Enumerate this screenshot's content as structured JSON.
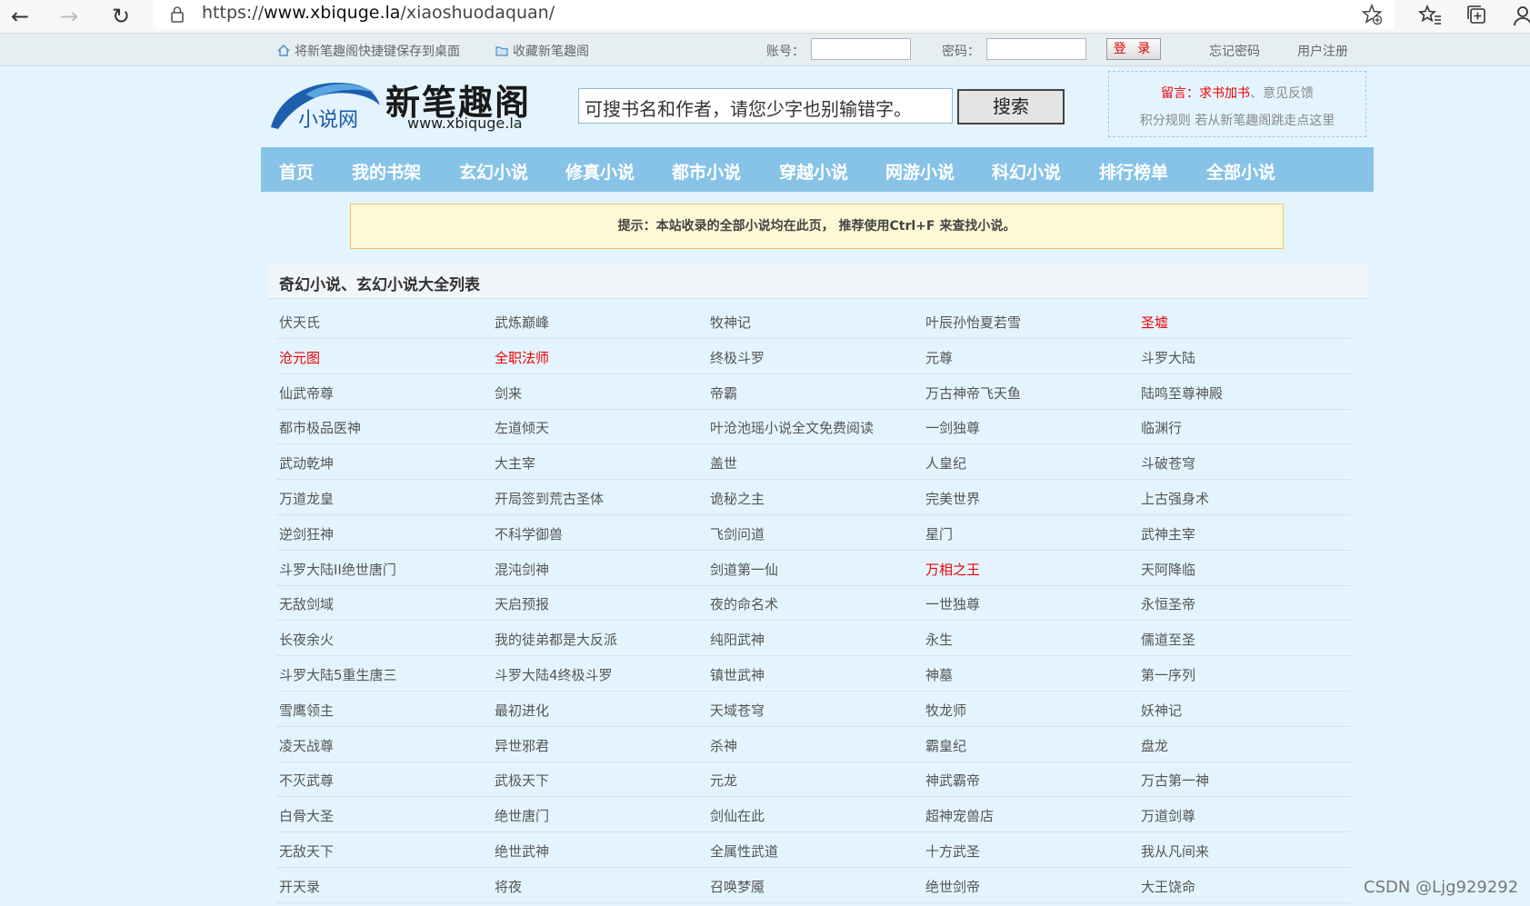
{
  "browser": {
    "url_prefix": "https://",
    "url_host": "www.xbiquge.la",
    "url_path": "/xiaoshuodaquan/"
  },
  "topbar": {
    "save_shortcut": "将新笔趣阁快捷键保存到桌面",
    "bookmark": "收藏新笔趣阁",
    "account_label": "账号：",
    "password_label": "密码：",
    "login_button": "登 录",
    "forgot_password": "忘记密码",
    "register": "用户注册"
  },
  "header": {
    "logo_main": "新笔趣阁",
    "logo_sub": "小说网",
    "logo_domain": "www.xbiquge.la",
    "search_placeholder": "可搜书名和作者，请您少字也别输错字。",
    "search_button": "搜索",
    "notice_prefix": "留言：",
    "notice_request": "求书加书",
    "notice_sep": "、",
    "notice_feedback": "意见反馈",
    "notice_line2": "积分规则   若从新笔趣阁跳走点这里"
  },
  "nav": [
    "首页",
    "我的书架",
    "玄幻小说",
    "修真小说",
    "都市小说",
    "穿越小说",
    "网游小说",
    "科幻小说",
    "排行榜单",
    "全部小说"
  ],
  "tip": "提示：本站收录的全部小说均在此页， 推荐使用Ctrl+F 来查找小说。",
  "list": {
    "title": "奇幻小说、玄幻小说大全列表",
    "rows": [
      [
        {
          "t": "伏天氏",
          "hot": false
        },
        {
          "t": "武炼巅峰",
          "hot": false
        },
        {
          "t": "牧神记",
          "hot": false
        },
        {
          "t": "叶辰孙怡夏若雪",
          "hot": false
        },
        {
          "t": "圣墟",
          "hot": true
        }
      ],
      [
        {
          "t": "沧元图",
          "hot": true
        },
        {
          "t": "全职法师",
          "hot": true
        },
        {
          "t": "终极斗罗",
          "hot": false
        },
        {
          "t": "元尊",
          "hot": false
        },
        {
          "t": "斗罗大陆",
          "hot": false
        }
      ],
      [
        {
          "t": "仙武帝尊",
          "hot": false
        },
        {
          "t": "剑来",
          "hot": false
        },
        {
          "t": "帝霸",
          "hot": false
        },
        {
          "t": "万古神帝飞天鱼",
          "hot": false
        },
        {
          "t": "陆鸣至尊神殿",
          "hot": false
        }
      ],
      [
        {
          "t": "都市极品医神",
          "hot": false
        },
        {
          "t": "左道倾天",
          "hot": false
        },
        {
          "t": "叶沧池瑶小说全文免费阅读",
          "hot": false
        },
        {
          "t": "一剑独尊",
          "hot": false
        },
        {
          "t": "临渊行",
          "hot": false
        }
      ],
      [
        {
          "t": "武动乾坤",
          "hot": false
        },
        {
          "t": "大主宰",
          "hot": false
        },
        {
          "t": "盖世",
          "hot": false
        },
        {
          "t": "人皇纪",
          "hot": false
        },
        {
          "t": "斗破苍穹",
          "hot": false
        }
      ],
      [
        {
          "t": "万道龙皇",
          "hot": false
        },
        {
          "t": "开局签到荒古圣体",
          "hot": false
        },
        {
          "t": "诡秘之主",
          "hot": false
        },
        {
          "t": "完美世界",
          "hot": false
        },
        {
          "t": "上古强身术",
          "hot": false
        }
      ],
      [
        {
          "t": "逆剑狂神",
          "hot": false
        },
        {
          "t": "不科学御兽",
          "hot": false
        },
        {
          "t": "飞剑问道",
          "hot": false
        },
        {
          "t": "星门",
          "hot": false
        },
        {
          "t": "武神主宰",
          "hot": false
        }
      ],
      [
        {
          "t": "斗罗大陆II绝世唐门",
          "hot": false
        },
        {
          "t": "混沌剑神",
          "hot": false
        },
        {
          "t": "剑道第一仙",
          "hot": false
        },
        {
          "t": "万相之王",
          "hot": true
        },
        {
          "t": "天阿降临",
          "hot": false
        }
      ],
      [
        {
          "t": "无敌剑域",
          "hot": false
        },
        {
          "t": "天启预报",
          "hot": false
        },
        {
          "t": "夜的命名术",
          "hot": false
        },
        {
          "t": "一世独尊",
          "hot": false
        },
        {
          "t": "永恒圣帝",
          "hot": false
        }
      ],
      [
        {
          "t": "长夜余火",
          "hot": false
        },
        {
          "t": "我的徒弟都是大反派",
          "hot": false
        },
        {
          "t": "纯阳武神",
          "hot": false
        },
        {
          "t": "永生",
          "hot": false
        },
        {
          "t": "儒道至圣",
          "hot": false
        }
      ],
      [
        {
          "t": "斗罗大陆5重生唐三",
          "hot": false
        },
        {
          "t": "斗罗大陆4终极斗罗",
          "hot": false
        },
        {
          "t": "镇世武神",
          "hot": false
        },
        {
          "t": "神墓",
          "hot": false
        },
        {
          "t": "第一序列",
          "hot": false
        }
      ],
      [
        {
          "t": "雪鹰领主",
          "hot": false
        },
        {
          "t": "最初进化",
          "hot": false
        },
        {
          "t": "天域苍穹",
          "hot": false
        },
        {
          "t": "牧龙师",
          "hot": false
        },
        {
          "t": "妖神记",
          "hot": false
        }
      ],
      [
        {
          "t": "凌天战尊",
          "hot": false
        },
        {
          "t": "异世邪君",
          "hot": false
        },
        {
          "t": "杀神",
          "hot": false
        },
        {
          "t": "霸皇纪",
          "hot": false
        },
        {
          "t": "盘龙",
          "hot": false
        }
      ],
      [
        {
          "t": "不灭武尊",
          "hot": false
        },
        {
          "t": "武极天下",
          "hot": false
        },
        {
          "t": "元龙",
          "hot": false
        },
        {
          "t": "神武霸帝",
          "hot": false
        },
        {
          "t": "万古第一神",
          "hot": false
        }
      ],
      [
        {
          "t": "白骨大圣",
          "hot": false
        },
        {
          "t": "绝世唐门",
          "hot": false
        },
        {
          "t": "剑仙在此",
          "hot": false
        },
        {
          "t": "超神宠兽店",
          "hot": false
        },
        {
          "t": "万道剑尊",
          "hot": false
        }
      ],
      [
        {
          "t": "无敌天下",
          "hot": false
        },
        {
          "t": "绝世武神",
          "hot": false
        },
        {
          "t": "全属性武道",
          "hot": false
        },
        {
          "t": "十方武圣",
          "hot": false
        },
        {
          "t": "我从凡间来",
          "hot": false
        }
      ],
      [
        {
          "t": "开天录",
          "hot": false
        },
        {
          "t": "将夜",
          "hot": false
        },
        {
          "t": "召唤梦魇",
          "hot": false
        },
        {
          "t": "绝世剑帝",
          "hot": false
        },
        {
          "t": "大王饶命",
          "hot": false
        }
      ]
    ]
  },
  "watermark": "CSDN @Ljg929292",
  "colors": {
    "nav_bg": "#87c3e7",
    "page_bg": "#e4f4fe",
    "hot": "#ee0000",
    "tip_bg": "#fdf9d6"
  }
}
